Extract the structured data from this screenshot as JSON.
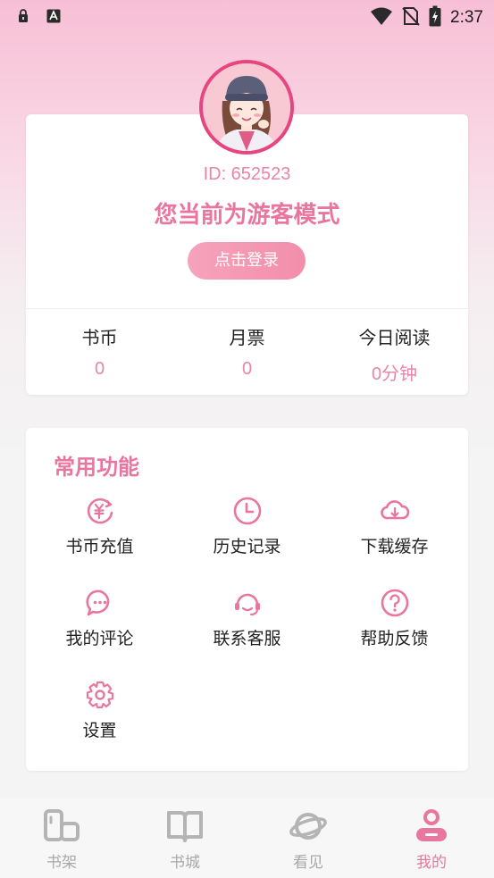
{
  "status_bar": {
    "time": "2:37",
    "left_icons": [
      "lock-icon",
      "font-a-icon"
    ],
    "right_icons": [
      "wifi-icon",
      "no-sim-icon",
      "battery-charging-icon"
    ]
  },
  "profile": {
    "id_text": "ID: 652523",
    "mode_text": "您当前为游客模式",
    "login_label": "点击登录",
    "avatar": "avatar-girl-with-beanie"
  },
  "stats": [
    {
      "label": "书币",
      "value": "0"
    },
    {
      "label": "月票",
      "value": "0"
    },
    {
      "label": "今日阅读",
      "value": "0分钟"
    }
  ],
  "functions": {
    "title": "常用功能",
    "items": [
      {
        "label": "书币充值",
        "icon": "coin-recharge-icon"
      },
      {
        "label": "历史记录",
        "icon": "clock-icon"
      },
      {
        "label": "下载缓存",
        "icon": "cloud-download-icon"
      },
      {
        "label": "我的评论",
        "icon": "comment-icon"
      },
      {
        "label": "联系客服",
        "icon": "headset-icon"
      },
      {
        "label": "帮助反馈",
        "icon": "help-icon"
      },
      {
        "label": "设置",
        "icon": "settings-gear-icon"
      }
    ]
  },
  "nav": {
    "items": [
      {
        "label": "书架",
        "icon": "bookshelf-icon",
        "active": false
      },
      {
        "label": "书城",
        "icon": "book-open-icon",
        "active": false
      },
      {
        "label": "看见",
        "icon": "planet-icon",
        "active": false
      },
      {
        "label": "我的",
        "icon": "profile-icon",
        "active": true
      }
    ]
  },
  "colors": {
    "accent": "#e8769f",
    "accent_light": "#ea84a8",
    "nav_inactive": "#a8a8a8",
    "avatar_ring": "#e6457f"
  }
}
